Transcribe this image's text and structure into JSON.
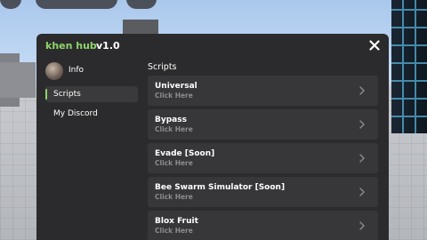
{
  "window": {
    "title_name": "khen hub",
    "title_version": "v1.0",
    "close_icon": "close-icon"
  },
  "sidebar": {
    "profile_label": "Info",
    "items": [
      {
        "label": "Scripts",
        "active": true
      },
      {
        "label": "My Discord",
        "active": false
      }
    ]
  },
  "main": {
    "section_title": "Scripts",
    "scripts": [
      {
        "name": "Universal",
        "action": "Click Here"
      },
      {
        "name": "Bypass",
        "action": "Click Here"
      },
      {
        "name": "Evade [Soon]",
        "action": "Click Here"
      },
      {
        "name": "Bee Swarm Simulator [Soon]",
        "action": "Click Here"
      },
      {
        "name": "Blox Fruit",
        "action": "Click Here"
      }
    ]
  },
  "colors": {
    "accent": "#8fd46a",
    "panel": "#2b2b2d",
    "item": "#37373a",
    "subtext": "#8c8c8e"
  }
}
